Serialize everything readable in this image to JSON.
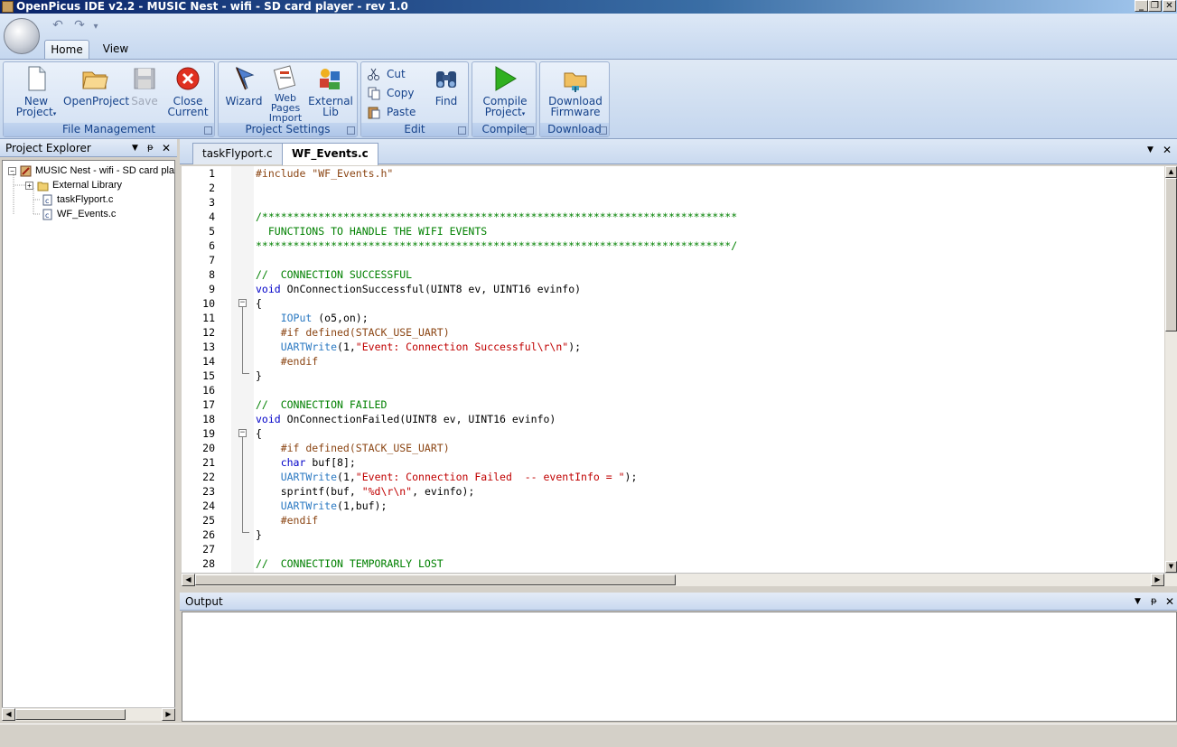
{
  "window": {
    "title": "OpenPicus IDE v2.2 - MUSIC Nest - wifi - SD card player - rev 1.0",
    "controls": [
      "_",
      "❐",
      "✕"
    ]
  },
  "qat": {
    "undo": "↶",
    "redo": "↷",
    "more": "▾"
  },
  "ribbon_tabs": [
    "Home",
    "View"
  ],
  "groups": {
    "file": {
      "label": "File Management",
      "new_project": "New\nProject",
      "open_project": "OpenProject",
      "save": "Save",
      "close_current": "Close\nCurrent"
    },
    "settings": {
      "label": "Project Settings",
      "wizard": "Wizard",
      "web_pages": "Web\nPages\nImport",
      "external_lib": "External\nLib"
    },
    "edit": {
      "label": "Edit",
      "cut": "Cut",
      "copy": "Copy",
      "paste": "Paste",
      "find": "Find"
    },
    "compile": {
      "label": "Compile",
      "compile_project": "Compile\nProject"
    },
    "download": {
      "label": "Download",
      "download_firmware": "Download\nFirmware"
    }
  },
  "explorer": {
    "title": "Project Explorer",
    "tree": [
      {
        "label": "MUSIC Nest - wifi - SD card play",
        "expander": "−"
      },
      {
        "label": "External Library",
        "expander": "+"
      },
      {
        "label": "taskFlyport.c",
        "expander": ""
      },
      {
        "label": "WF_Events.c",
        "expander": ""
      }
    ]
  },
  "editor": {
    "tabs": [
      "taskFlyport.c",
      "WF_Events.c"
    ],
    "active_tab": "WF_Events.c",
    "line_numbers": [
      "1",
      "2",
      "3",
      "4",
      "5",
      "6",
      "7",
      "8",
      "9",
      "10",
      "11",
      "12",
      "13",
      "14",
      "15",
      "16",
      "17",
      "18",
      "19",
      "20",
      "21",
      "22",
      "23",
      "24",
      "25",
      "26",
      "27",
      "28"
    ],
    "lines": [
      "#include \"WF_Events.h\"",
      "",
      "",
      "/****************************************************************************",
      "  FUNCTIONS TO HANDLE THE WIFI EVENTS",
      "****************************************************************************/",
      "",
      "//  CONNECTION SUCCESSFUL",
      "void OnConnectionSuccessful(UINT8 ev, UINT16 evinfo)",
      "{",
      "    IOPut (o5,on);",
      "    #if defined(STACK_USE_UART)",
      "    UARTWrite(1,\"Event: Connection Successful\\r\\n\");",
      "    #endif",
      "}",
      "",
      "//  CONNECTION FAILED",
      "void OnConnectionFailed(UINT8 ev, UINT16 evinfo)",
      "{",
      "    #if defined(STACK_USE_UART)",
      "    char buf[8];",
      "    UARTWrite(1,\"Event: Connection Failed  -- eventInfo = \");",
      "    sprintf(buf, \"%d\\r\\n\", evinfo);",
      "    UARTWrite(1,buf);",
      "    #endif",
      "}",
      "",
      "//  CONNECTION TEMPORARLY LOST"
    ]
  },
  "output": {
    "title": "Output"
  },
  "panel_controls": {
    "dropdown": "▼",
    "pin": "📌",
    "close": "✕"
  },
  "colors": {
    "preprocessor": "#8b4513",
    "comment": "#008000",
    "keyword": "#0000c8",
    "string": "#c00000",
    "function": "#2b79c2"
  }
}
